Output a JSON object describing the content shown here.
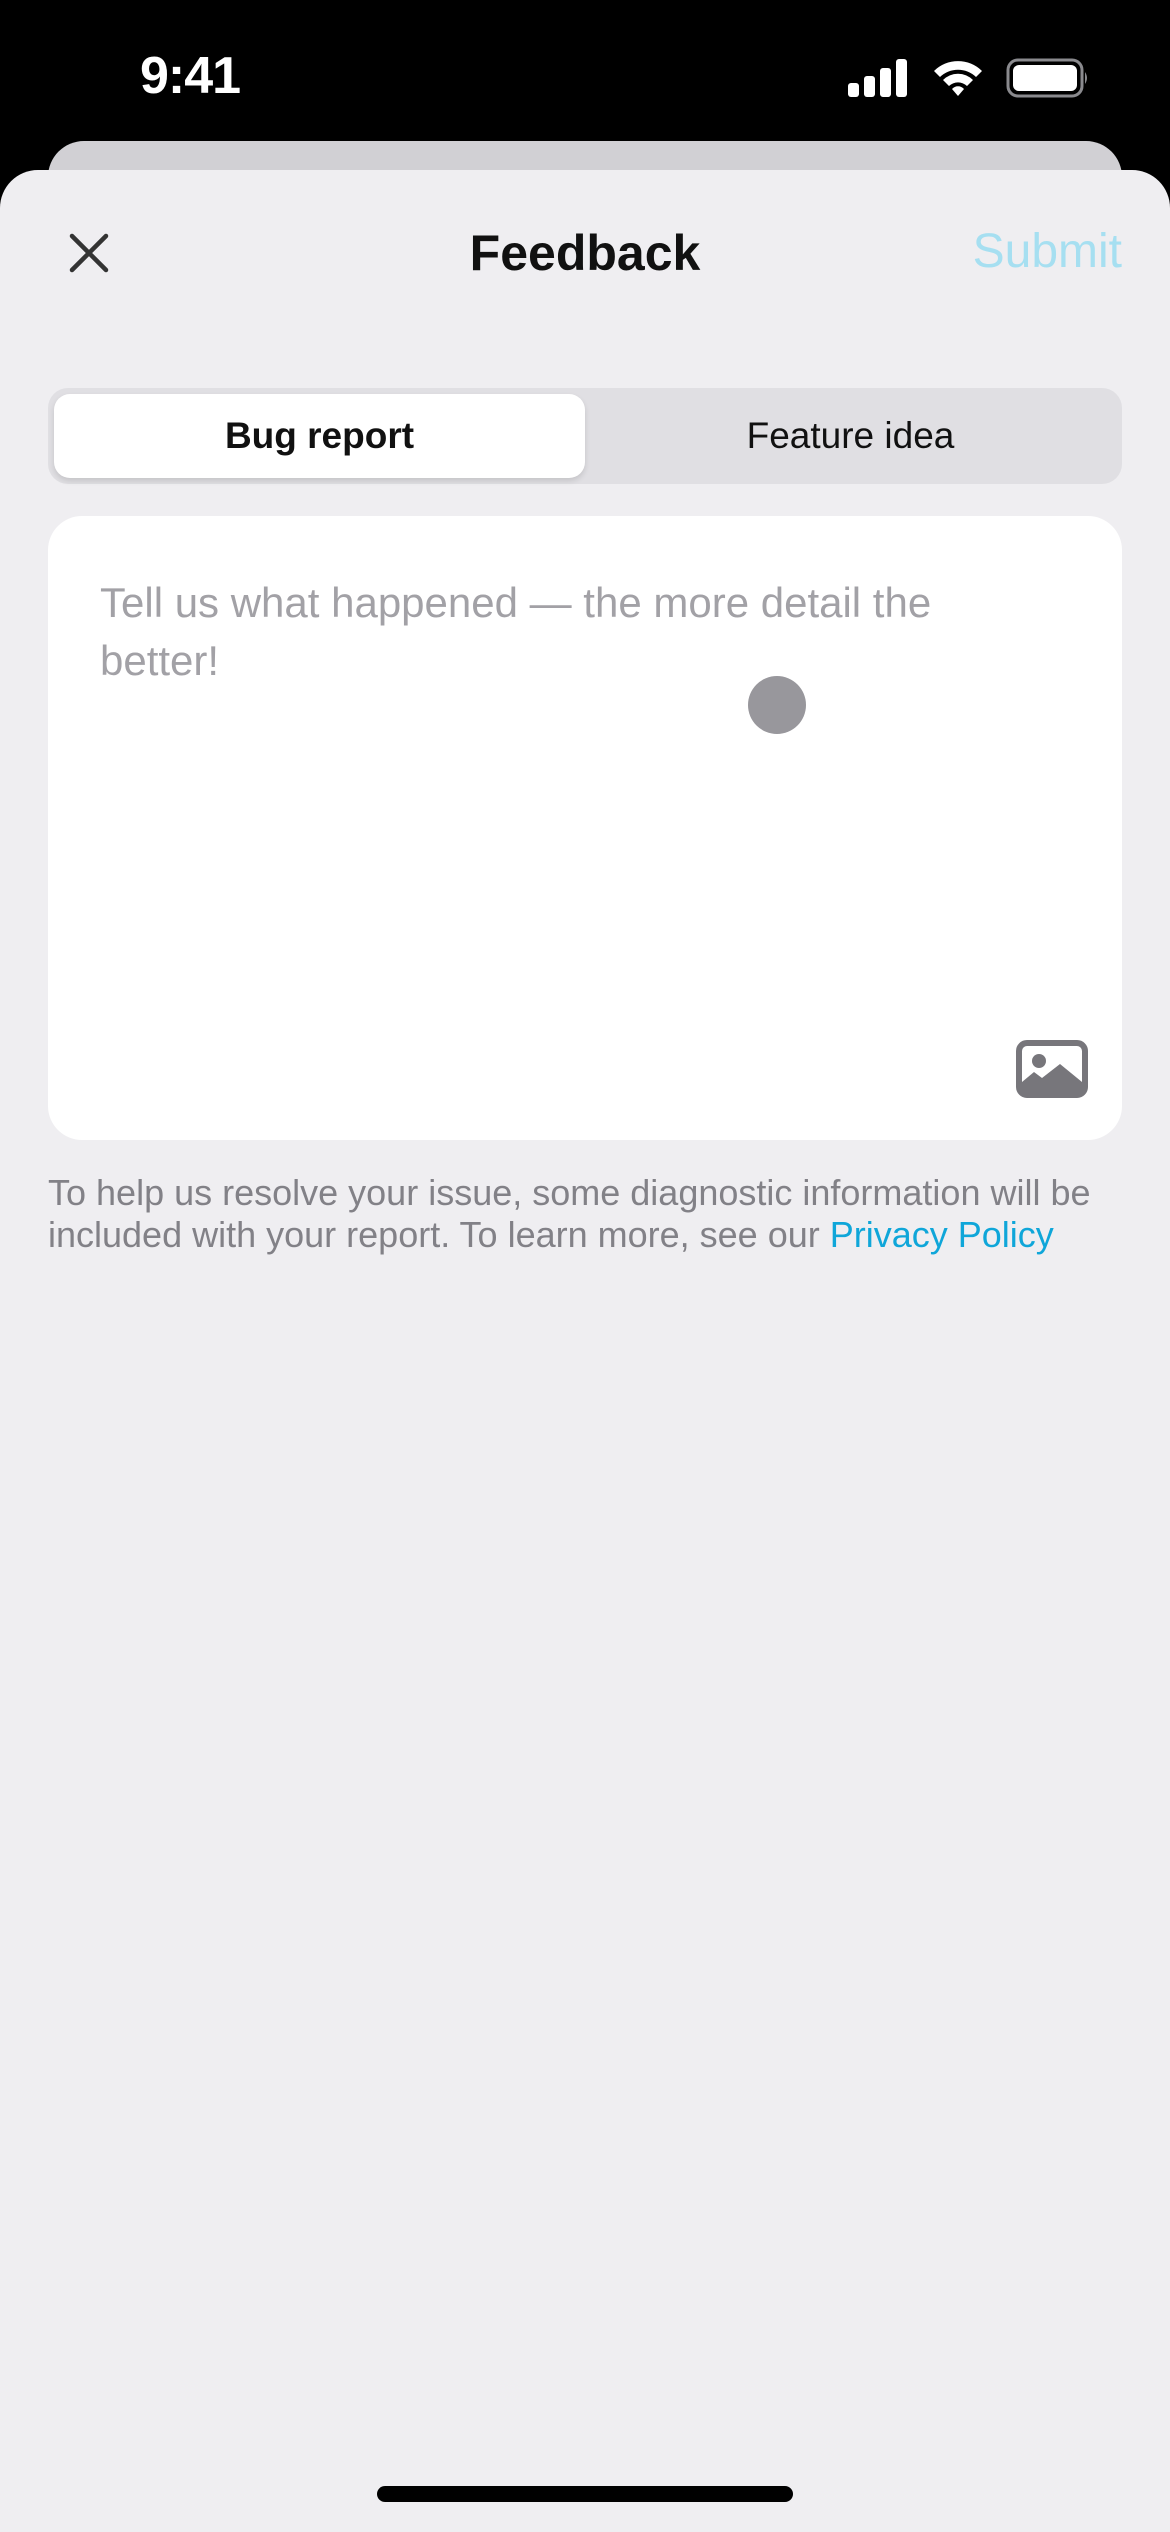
{
  "status_bar": {
    "time": "9:41",
    "icons": [
      "cellular-signal-icon",
      "wifi-icon",
      "battery-icon"
    ]
  },
  "nav": {
    "close_icon": "close-icon",
    "title": "Feedback",
    "submit_label": "Submit"
  },
  "segmented_control": {
    "selected_index": 0,
    "options": [
      {
        "label": "Bug report"
      },
      {
        "label": "Feature idea"
      }
    ]
  },
  "feedback_input": {
    "value": "",
    "placeholder": "Tell us what happened — the more detail the better!",
    "attach_icon": "image-icon"
  },
  "disclaimer": {
    "text": "To help us resolve your issue, some diagnostic information will be included with your report. To learn more, see our ",
    "link_label": "Privacy Policy"
  },
  "colors": {
    "accent": "#0fa6d9",
    "submit_disabled": "#a6dff1",
    "sheet_background": "#efeef1",
    "placeholder": "#a2a1a6",
    "secondary_text": "#828187"
  }
}
